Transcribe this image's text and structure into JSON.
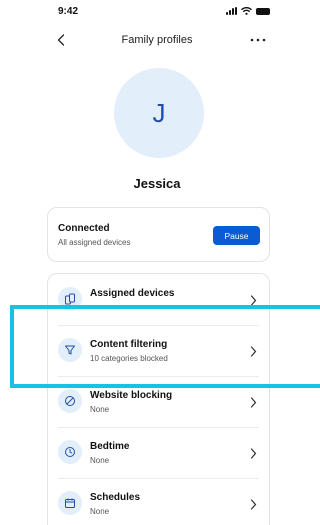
{
  "status_bar": {
    "time": "9:42",
    "icons": [
      "signal-icon",
      "wifi-icon",
      "battery-icon"
    ]
  },
  "nav": {
    "title": "Family profiles",
    "back_icon": "chevron-left-icon",
    "more_icon": "more-horizontal-icon"
  },
  "profile": {
    "initial": "J",
    "name": "Jessica"
  },
  "connection": {
    "title": "Connected",
    "subtitle": "All assigned devices",
    "pause_label": "Pause"
  },
  "settings": {
    "items": [
      {
        "title": "Assigned devices",
        "subtitle": "",
        "icon": "devices-icon"
      },
      {
        "title": "Content filtering",
        "subtitle": "10 categories blocked",
        "icon": "filter-icon"
      },
      {
        "title": "Website blocking",
        "subtitle": "None",
        "icon": "block-icon"
      },
      {
        "title": "Bedtime",
        "subtitle": "None",
        "icon": "clock-icon"
      },
      {
        "title": "Schedules",
        "subtitle": "None",
        "icon": "calendar-icon"
      }
    ]
  },
  "colors": {
    "accent": "#0b5bd3",
    "avatar_bg": "#e3eefb",
    "highlight": "#19c1e8"
  }
}
